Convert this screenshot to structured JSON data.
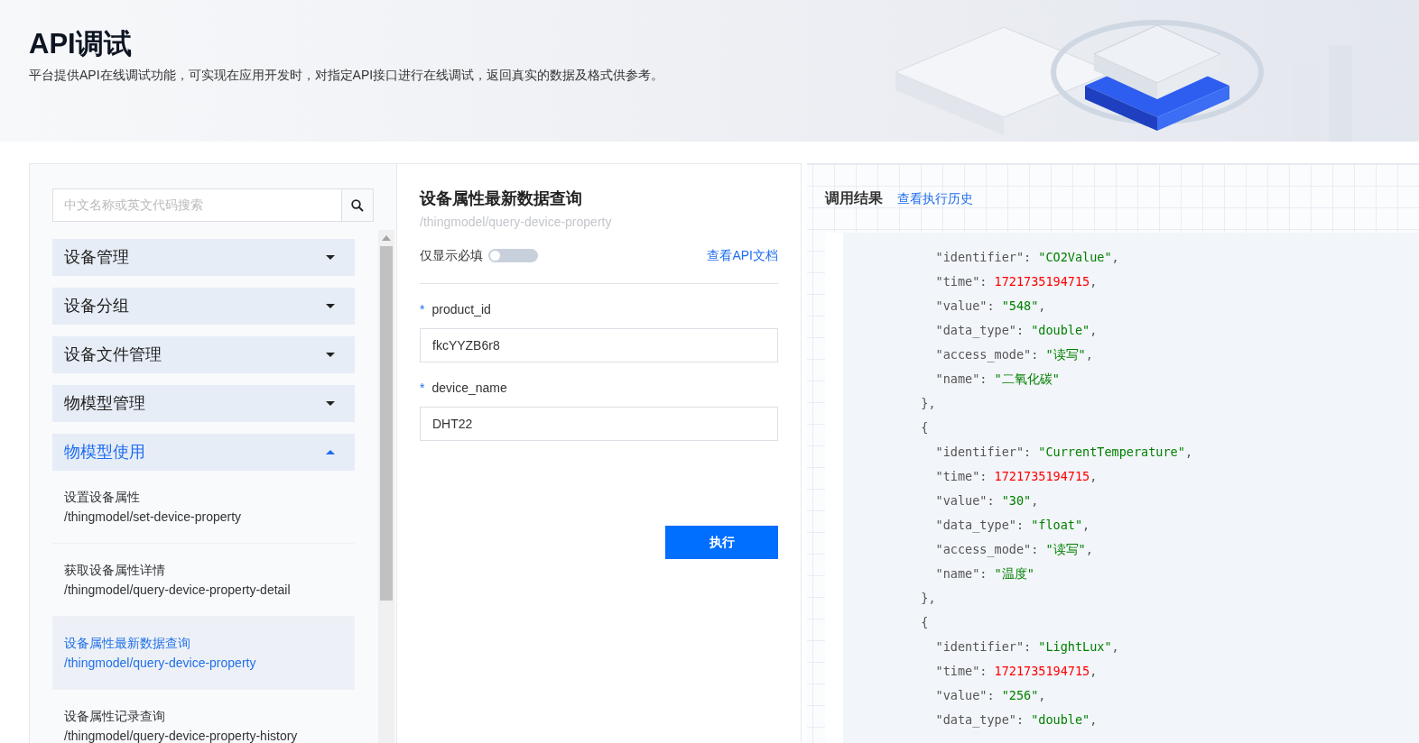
{
  "header": {
    "title": "API调试",
    "description": "平台提供API在线调试功能，可实现在应用开发时，对指定API接口进行在线调试，返回真实的数据及格式供参考。"
  },
  "sidebar": {
    "search": {
      "placeholder": "中文名称或英文代码搜索"
    },
    "groups": [
      {
        "label": "设备管理",
        "expanded": false
      },
      {
        "label": "设备分组",
        "expanded": false
      },
      {
        "label": "设备文件管理",
        "expanded": false
      },
      {
        "label": "物模型管理",
        "expanded": false
      },
      {
        "label": "物模型使用",
        "expanded": true,
        "items": [
          {
            "title": "设置设备属性",
            "path": "/thingmodel/set-device-property",
            "selected": false
          },
          {
            "title": "获取设备属性详情",
            "path": "/thingmodel/query-device-property-detail",
            "selected": false
          },
          {
            "title": "设备属性最新数据查询",
            "path": "/thingmodel/query-device-property",
            "selected": true
          },
          {
            "title": "设备属性记录查询",
            "path": "/thingmodel/query-device-property-history",
            "selected": false
          }
        ]
      }
    ]
  },
  "form": {
    "title": "设备属性最新数据查询",
    "path": "/thingmodel/query-device-property",
    "required_only": {
      "label": "仅显示必填",
      "on": false
    },
    "doc_link": "查看API文档",
    "fields": [
      {
        "required_mark": "*",
        "label": "product_id",
        "value": "fkcYYZB6r8"
      },
      {
        "required_mark": "*",
        "label": "device_name",
        "value": "DHT22"
      }
    ],
    "submit": "执行"
  },
  "result": {
    "title": "调用结果",
    "history_link": "查看执行历史",
    "lines": [
      [
        {
          "kind": "key",
          "text": "    \"identifier\""
        },
        {
          "kind": "punct",
          "text": ": "
        },
        {
          "kind": "string",
          "text": "\"CO2Value\""
        },
        {
          "kind": "punct",
          "text": ","
        }
      ],
      [
        {
          "kind": "key",
          "text": "    \"time\""
        },
        {
          "kind": "punct",
          "text": ": "
        },
        {
          "kind": "number",
          "text": "1721735194715"
        },
        {
          "kind": "punct",
          "text": ","
        }
      ],
      [
        {
          "kind": "key",
          "text": "    \"value\""
        },
        {
          "kind": "punct",
          "text": ": "
        },
        {
          "kind": "string",
          "text": "\"548\""
        },
        {
          "kind": "punct",
          "text": ","
        }
      ],
      [
        {
          "kind": "key",
          "text": "    \"data_type\""
        },
        {
          "kind": "punct",
          "text": ": "
        },
        {
          "kind": "string",
          "text": "\"double\""
        },
        {
          "kind": "punct",
          "text": ","
        }
      ],
      [
        {
          "kind": "key",
          "text": "    \"access_mode\""
        },
        {
          "kind": "punct",
          "text": ": "
        },
        {
          "kind": "string",
          "text": "\"读写\""
        },
        {
          "kind": "punct",
          "text": ","
        }
      ],
      [
        {
          "kind": "key",
          "text": "    \"name\""
        },
        {
          "kind": "punct",
          "text": ": "
        },
        {
          "kind": "string",
          "text": "\"二氧化碳\""
        }
      ],
      [
        {
          "kind": "punct",
          "text": "  },"
        }
      ],
      [
        {
          "kind": "punct",
          "text": "  {"
        }
      ],
      [
        {
          "kind": "key",
          "text": "    \"identifier\""
        },
        {
          "kind": "punct",
          "text": ": "
        },
        {
          "kind": "string",
          "text": "\"CurrentTemperature\""
        },
        {
          "kind": "punct",
          "text": ","
        }
      ],
      [
        {
          "kind": "key",
          "text": "    \"time\""
        },
        {
          "kind": "punct",
          "text": ": "
        },
        {
          "kind": "number",
          "text": "1721735194715"
        },
        {
          "kind": "punct",
          "text": ","
        }
      ],
      [
        {
          "kind": "key",
          "text": "    \"value\""
        },
        {
          "kind": "punct",
          "text": ": "
        },
        {
          "kind": "string",
          "text": "\"30\""
        },
        {
          "kind": "punct",
          "text": ","
        }
      ],
      [
        {
          "kind": "key",
          "text": "    \"data_type\""
        },
        {
          "kind": "punct",
          "text": ": "
        },
        {
          "kind": "string",
          "text": "\"float\""
        },
        {
          "kind": "punct",
          "text": ","
        }
      ],
      [
        {
          "kind": "key",
          "text": "    \"access_mode\""
        },
        {
          "kind": "punct",
          "text": ": "
        },
        {
          "kind": "string",
          "text": "\"读写\""
        },
        {
          "kind": "punct",
          "text": ","
        }
      ],
      [
        {
          "kind": "key",
          "text": "    \"name\""
        },
        {
          "kind": "punct",
          "text": ": "
        },
        {
          "kind": "string",
          "text": "\"温度\""
        }
      ],
      [
        {
          "kind": "punct",
          "text": "  },"
        }
      ],
      [
        {
          "kind": "punct",
          "text": "  {"
        }
      ],
      [
        {
          "kind": "key",
          "text": "    \"identifier\""
        },
        {
          "kind": "punct",
          "text": ": "
        },
        {
          "kind": "string",
          "text": "\"LightLux\""
        },
        {
          "kind": "punct",
          "text": ","
        }
      ],
      [
        {
          "kind": "key",
          "text": "    \"time\""
        },
        {
          "kind": "punct",
          "text": ": "
        },
        {
          "kind": "number",
          "text": "1721735194715"
        },
        {
          "kind": "punct",
          "text": ","
        }
      ],
      [
        {
          "kind": "key",
          "text": "    \"value\""
        },
        {
          "kind": "punct",
          "text": ": "
        },
        {
          "kind": "string",
          "text": "\"256\""
        },
        {
          "kind": "punct",
          "text": ","
        }
      ],
      [
        {
          "kind": "key",
          "text": "    \"data_type\""
        },
        {
          "kind": "punct",
          "text": ": "
        },
        {
          "kind": "string",
          "text": "\"double\""
        },
        {
          "kind": "punct",
          "text": ","
        }
      ]
    ]
  }
}
